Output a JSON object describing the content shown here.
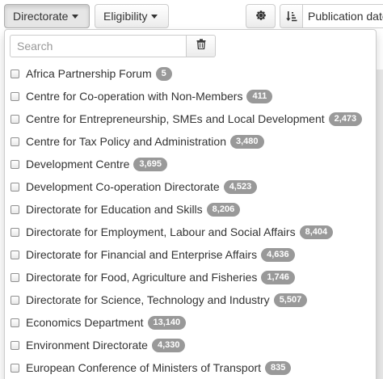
{
  "toolbar": {
    "directorate_label": "Directorate",
    "eligibility_label": "Eligibility",
    "settings_icon": "gear-icon",
    "sort_icon": "sort-descending-icon",
    "sort_label": "Publication date"
  },
  "dropdown": {
    "search_placeholder": "Search",
    "search_value": "",
    "clear_icon": "trash-icon",
    "items": [
      {
        "label": "Africa Partnership Forum",
        "count": "5",
        "checked": false
      },
      {
        "label": "Centre for Co-operation with Non-Members",
        "count": "411",
        "checked": false
      },
      {
        "label": "Centre for Entrepreneurship, SMEs and Local Development",
        "count": "2,473",
        "checked": false
      },
      {
        "label": "Centre for Tax Policy and Administration",
        "count": "3,480",
        "checked": false
      },
      {
        "label": "Development Centre",
        "count": "3,695",
        "checked": false
      },
      {
        "label": "Development Co-operation Directorate",
        "count": "4,523",
        "checked": false
      },
      {
        "label": "Directorate for Education and Skills",
        "count": "8,206",
        "checked": false
      },
      {
        "label": "Directorate for Employment, Labour and Social Affairs",
        "count": "8,404",
        "checked": false
      },
      {
        "label": "Directorate for Financial and Enterprise Affairs",
        "count": "4,636",
        "checked": false
      },
      {
        "label": "Directorate for Food, Agriculture and Fisheries",
        "count": "1,746",
        "checked": false
      },
      {
        "label": "Directorate for Science, Technology and Industry",
        "count": "5,507",
        "checked": false
      },
      {
        "label": "Economics Department",
        "count": "13,140",
        "checked": false
      },
      {
        "label": "Environment Directorate",
        "count": "4,330",
        "checked": false
      },
      {
        "label": "European Conference of Ministers of Transport",
        "count": "835",
        "checked": false
      }
    ]
  }
}
